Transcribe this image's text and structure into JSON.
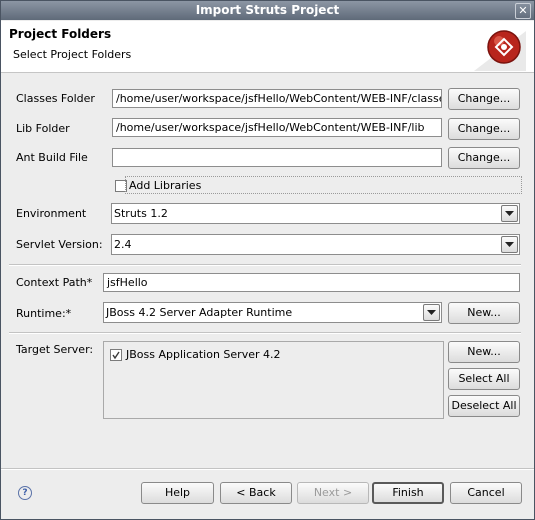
{
  "window": {
    "title": "Import Struts Project"
  },
  "header": {
    "title": "Project Folders",
    "subtitle": "Select Project Folders"
  },
  "form": {
    "classes_folder": {
      "label": "Classes Folder",
      "value": "/home/user/workspace/jsfHello/WebContent/WEB-INF/classes",
      "button": "Change..."
    },
    "lib_folder": {
      "label": "Lib Folder",
      "value": "/home/user/workspace/jsfHello/WebContent/WEB-INF/lib",
      "button": "Change..."
    },
    "ant_build_file": {
      "label": "Ant Build File",
      "value": "",
      "button": "Change..."
    },
    "add_libraries": {
      "label": "Add Libraries",
      "checked": false
    },
    "environment": {
      "label": "Environment",
      "value": "Struts 1.2"
    },
    "servlet_version": {
      "label": "Servlet Version:",
      "value": "2.4"
    },
    "context_path": {
      "label": "Context Path*",
      "value": "jsfHello"
    },
    "runtime": {
      "label": "Runtime:*",
      "value": "JBoss 4.2 Server Adapter Runtime",
      "button": "New..."
    },
    "target_server": {
      "label": "Target Server:",
      "items": [
        {
          "label": "JBoss Application Server 4.2",
          "checked": true
        }
      ],
      "new_button": "New...",
      "select_all_button": "Select All",
      "deselect_all_button": "Deselect All"
    }
  },
  "footer": {
    "help": "Help",
    "back": "< Back",
    "next": "Next >",
    "finish": "Finish",
    "cancel": "Cancel"
  },
  "icons": {
    "close": "close-icon",
    "help": "help-icon",
    "logo": "struts-logo-icon",
    "dropdown": "chevron-down-icon"
  }
}
